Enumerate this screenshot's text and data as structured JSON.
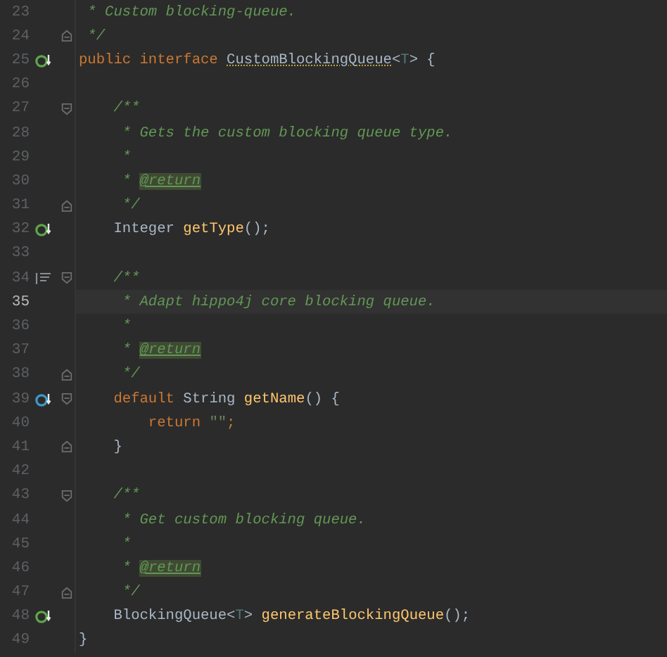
{
  "editor": {
    "lines": [
      {
        "number": "23",
        "current": false,
        "tokens": [
          {
            "kind": "comment",
            "text": " * Custom blocking-queue."
          }
        ]
      },
      {
        "number": "24",
        "current": false,
        "fold": {
          "kind": "end"
        },
        "tokens": [
          {
            "kind": "comment",
            "text": " */"
          }
        ]
      },
      {
        "number": "25",
        "current": false,
        "marker": {
          "kind": "implemented"
        },
        "tokens": [
          {
            "kind": "keyword",
            "text": "public interface "
          },
          {
            "kind": "declaration",
            "text": "CustomBlockingQueue"
          },
          {
            "kind": "plain",
            "text": "<"
          },
          {
            "kind": "typeparam",
            "text": "T"
          },
          {
            "kind": "plain",
            "text": "> {"
          }
        ]
      },
      {
        "number": "26",
        "current": false
      },
      {
        "number": "27",
        "current": false,
        "fold": {
          "kind": "start"
        },
        "tokens": [
          {
            "kind": "comment",
            "text": "    /**"
          }
        ]
      },
      {
        "number": "28",
        "current": false,
        "tokens": [
          {
            "kind": "comment",
            "text": "     * Gets the custom blocking queue type."
          }
        ]
      },
      {
        "number": "29",
        "current": false,
        "tokens": [
          {
            "kind": "comment",
            "text": "     *"
          }
        ]
      },
      {
        "number": "30",
        "current": false,
        "tokens": [
          {
            "kind": "comment",
            "text": "     * "
          },
          {
            "kind": "doctag",
            "text": "@return"
          }
        ]
      },
      {
        "number": "31",
        "current": false,
        "fold": {
          "kind": "end"
        },
        "tokens": [
          {
            "kind": "comment",
            "text": "     */"
          }
        ]
      },
      {
        "number": "32",
        "current": false,
        "marker": {
          "kind": "implemented"
        },
        "tokens": [
          {
            "kind": "plain",
            "text": "    Integer "
          },
          {
            "kind": "method",
            "text": "getType"
          },
          {
            "kind": "plain",
            "text": "();"
          }
        ]
      },
      {
        "number": "33",
        "current": false
      },
      {
        "number": "34",
        "current": false,
        "marker": {
          "kind": "doc"
        },
        "fold": {
          "kind": "start"
        },
        "tokens": [
          {
            "kind": "comment",
            "text": "    /**"
          }
        ]
      },
      {
        "number": "35",
        "current": true,
        "tokens": [
          {
            "kind": "comment",
            "text": "     * Adapt hippo4j core blocking queue."
          }
        ]
      },
      {
        "number": "36",
        "current": false,
        "tokens": [
          {
            "kind": "comment",
            "text": "     *"
          }
        ]
      },
      {
        "number": "37",
        "current": false,
        "tokens": [
          {
            "kind": "comment",
            "text": "     * "
          },
          {
            "kind": "doctag",
            "text": "@return"
          }
        ]
      },
      {
        "number": "38",
        "current": false,
        "fold": {
          "kind": "end"
        },
        "tokens": [
          {
            "kind": "comment",
            "text": "     */"
          }
        ]
      },
      {
        "number": "39",
        "current": false,
        "marker": {
          "kind": "overridden"
        },
        "fold": {
          "kind": "start"
        },
        "tokens": [
          {
            "kind": "keyword",
            "text": "    default "
          },
          {
            "kind": "plain",
            "text": "String "
          },
          {
            "kind": "method",
            "text": "getName"
          },
          {
            "kind": "plain",
            "text": "() {"
          }
        ]
      },
      {
        "number": "40",
        "current": false,
        "tokens": [
          {
            "kind": "keyword",
            "text": "        return "
          },
          {
            "kind": "string",
            "text": "\"\""
          },
          {
            "kind": "keyword",
            "text": ";"
          }
        ]
      },
      {
        "number": "41",
        "current": false,
        "fold": {
          "kind": "end"
        },
        "tokens": [
          {
            "kind": "plain",
            "text": "    }"
          }
        ]
      },
      {
        "number": "42",
        "current": false
      },
      {
        "number": "43",
        "current": false,
        "fold": {
          "kind": "start"
        },
        "tokens": [
          {
            "kind": "comment",
            "text": "    /**"
          }
        ]
      },
      {
        "number": "44",
        "current": false,
        "tokens": [
          {
            "kind": "comment",
            "text": "     * Get custom blocking queue."
          }
        ]
      },
      {
        "number": "45",
        "current": false,
        "tokens": [
          {
            "kind": "comment",
            "text": "     *"
          }
        ]
      },
      {
        "number": "46",
        "current": false,
        "tokens": [
          {
            "kind": "comment",
            "text": "     * "
          },
          {
            "kind": "doctag",
            "text": "@return"
          }
        ]
      },
      {
        "number": "47",
        "current": false,
        "fold": {
          "kind": "end"
        },
        "tokens": [
          {
            "kind": "comment",
            "text": "     */"
          }
        ]
      },
      {
        "number": "48",
        "current": false,
        "marker": {
          "kind": "implemented"
        },
        "tokens": [
          {
            "kind": "plain",
            "text": "    BlockingQueue<"
          },
          {
            "kind": "typeparam",
            "text": "T"
          },
          {
            "kind": "plain",
            "text": "> "
          },
          {
            "kind": "method",
            "text": "generateBlockingQueue"
          },
          {
            "kind": "plain",
            "text": "();"
          }
        ]
      },
      {
        "number": "49",
        "current": false,
        "tokens": [
          {
            "kind": "plain",
            "text": "}"
          }
        ]
      }
    ]
  }
}
